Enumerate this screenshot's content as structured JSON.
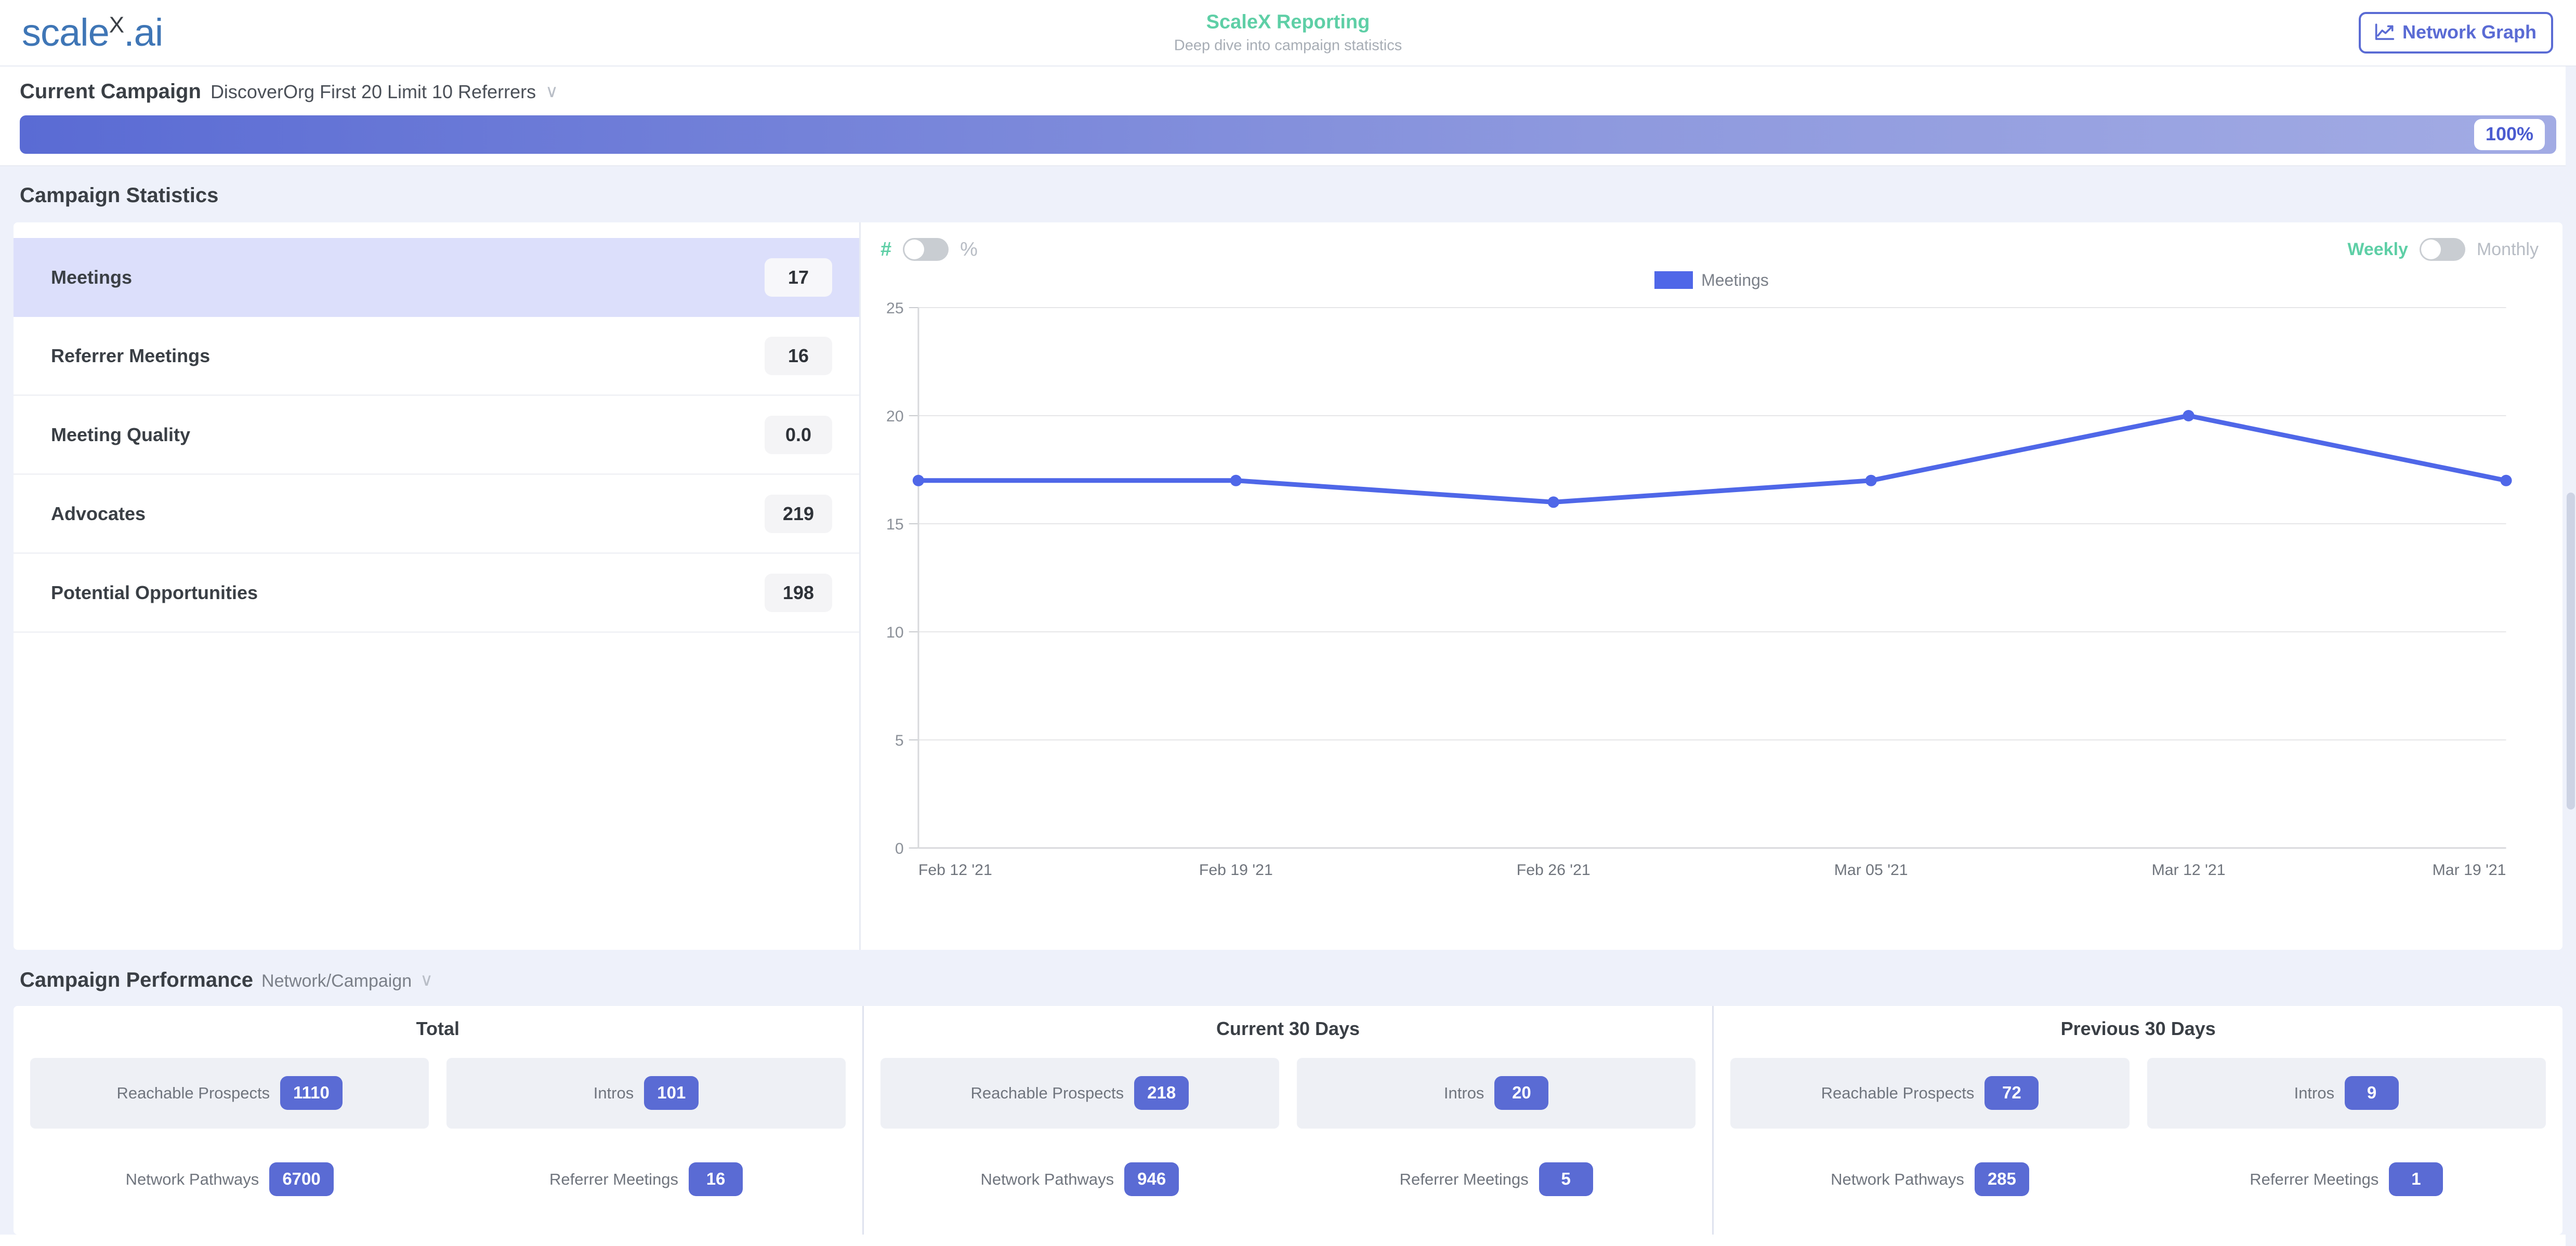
{
  "header": {
    "logo": {
      "main": "scale",
      "sup": "X",
      "suffix": ".ai"
    },
    "title": "ScaleX Reporting",
    "subtitle": "Deep dive into campaign statistics",
    "network_graph_button": "Network Graph"
  },
  "campaign": {
    "label": "Current Campaign",
    "value": "DiscoverOrg First 20 Limit 10 Referrers",
    "chevron": "∨",
    "progress_text": "100%",
    "progress_percent": 100
  },
  "statistics": {
    "section_title": "Campaign Statistics",
    "rows": [
      {
        "name": "Meetings",
        "value": "17",
        "selected": true
      },
      {
        "name": "Referrer Meetings",
        "value": "16",
        "selected": false
      },
      {
        "name": "Meeting Quality",
        "value": "0.0",
        "selected": false
      },
      {
        "name": "Advocates",
        "value": "219",
        "selected": false
      },
      {
        "name": "Potential Opportunities",
        "value": "198",
        "selected": false
      }
    ]
  },
  "chart_controls": {
    "left_on_label": "#",
    "left_off_label": "%",
    "left_toggle_state": "off",
    "right_on_label": "Weekly",
    "right_off_label": "Monthly",
    "right_toggle_state": "off"
  },
  "chart_data": {
    "type": "line",
    "title": "",
    "xlabel": "",
    "ylabel": "",
    "legend": [
      {
        "name": "Meetings",
        "color": "#4f67e8"
      }
    ],
    "legend_position": "top-center",
    "grid": true,
    "categories": [
      "Feb 12 '21",
      "Feb 19 '21",
      "Feb 26 '21",
      "Mar 05 '21",
      "Mar 12 '21",
      "Mar 19 '21"
    ],
    "series": [
      {
        "name": "Meetings",
        "values": [
          17,
          17,
          16,
          17,
          20,
          17
        ]
      }
    ],
    "ylim": [
      0,
      25
    ],
    "yticks": [
      0,
      5,
      10,
      15,
      20,
      25
    ],
    "ytick_labels": [
      "0",
      "5",
      "10",
      "15",
      "20",
      "25"
    ],
    "xtick_labels": [
      "Feb 12 '21",
      "Feb 19 '21",
      "Feb 26 '21",
      "Mar 05 '21",
      "Mar 12 '21",
      "Mar 19 '21"
    ]
  },
  "performance": {
    "label": "Campaign Performance",
    "value": "Network/Campaign",
    "chevron": "∨",
    "columns": [
      {
        "title": "Total",
        "cards": [
          {
            "label": "Reachable Prospects",
            "value": "1110"
          },
          {
            "label": "Intros",
            "value": "101"
          },
          {
            "label": "Network Pathways",
            "value": "6700"
          },
          {
            "label": "Referrer Meetings",
            "value": "16"
          }
        ]
      },
      {
        "title": "Current 30 Days",
        "cards": [
          {
            "label": "Reachable Prospects",
            "value": "218"
          },
          {
            "label": "Intros",
            "value": "20"
          },
          {
            "label": "Network Pathways",
            "value": "946"
          },
          {
            "label": "Referrer Meetings",
            "value": "5"
          }
        ]
      },
      {
        "title": "Previous 30 Days",
        "cards": [
          {
            "label": "Reachable Prospects",
            "value": "72"
          },
          {
            "label": "Intros",
            "value": "9"
          },
          {
            "label": "Network Pathways",
            "value": "285"
          },
          {
            "label": "Referrer Meetings",
            "value": "1"
          }
        ]
      }
    ]
  },
  "colors": {
    "brand_green": "#5ecfa6",
    "indigo": "#5a6bd4",
    "chart_line": "#4f67e8",
    "logo_blue": "#3f76b6",
    "page_bg": "#eef1fa"
  }
}
